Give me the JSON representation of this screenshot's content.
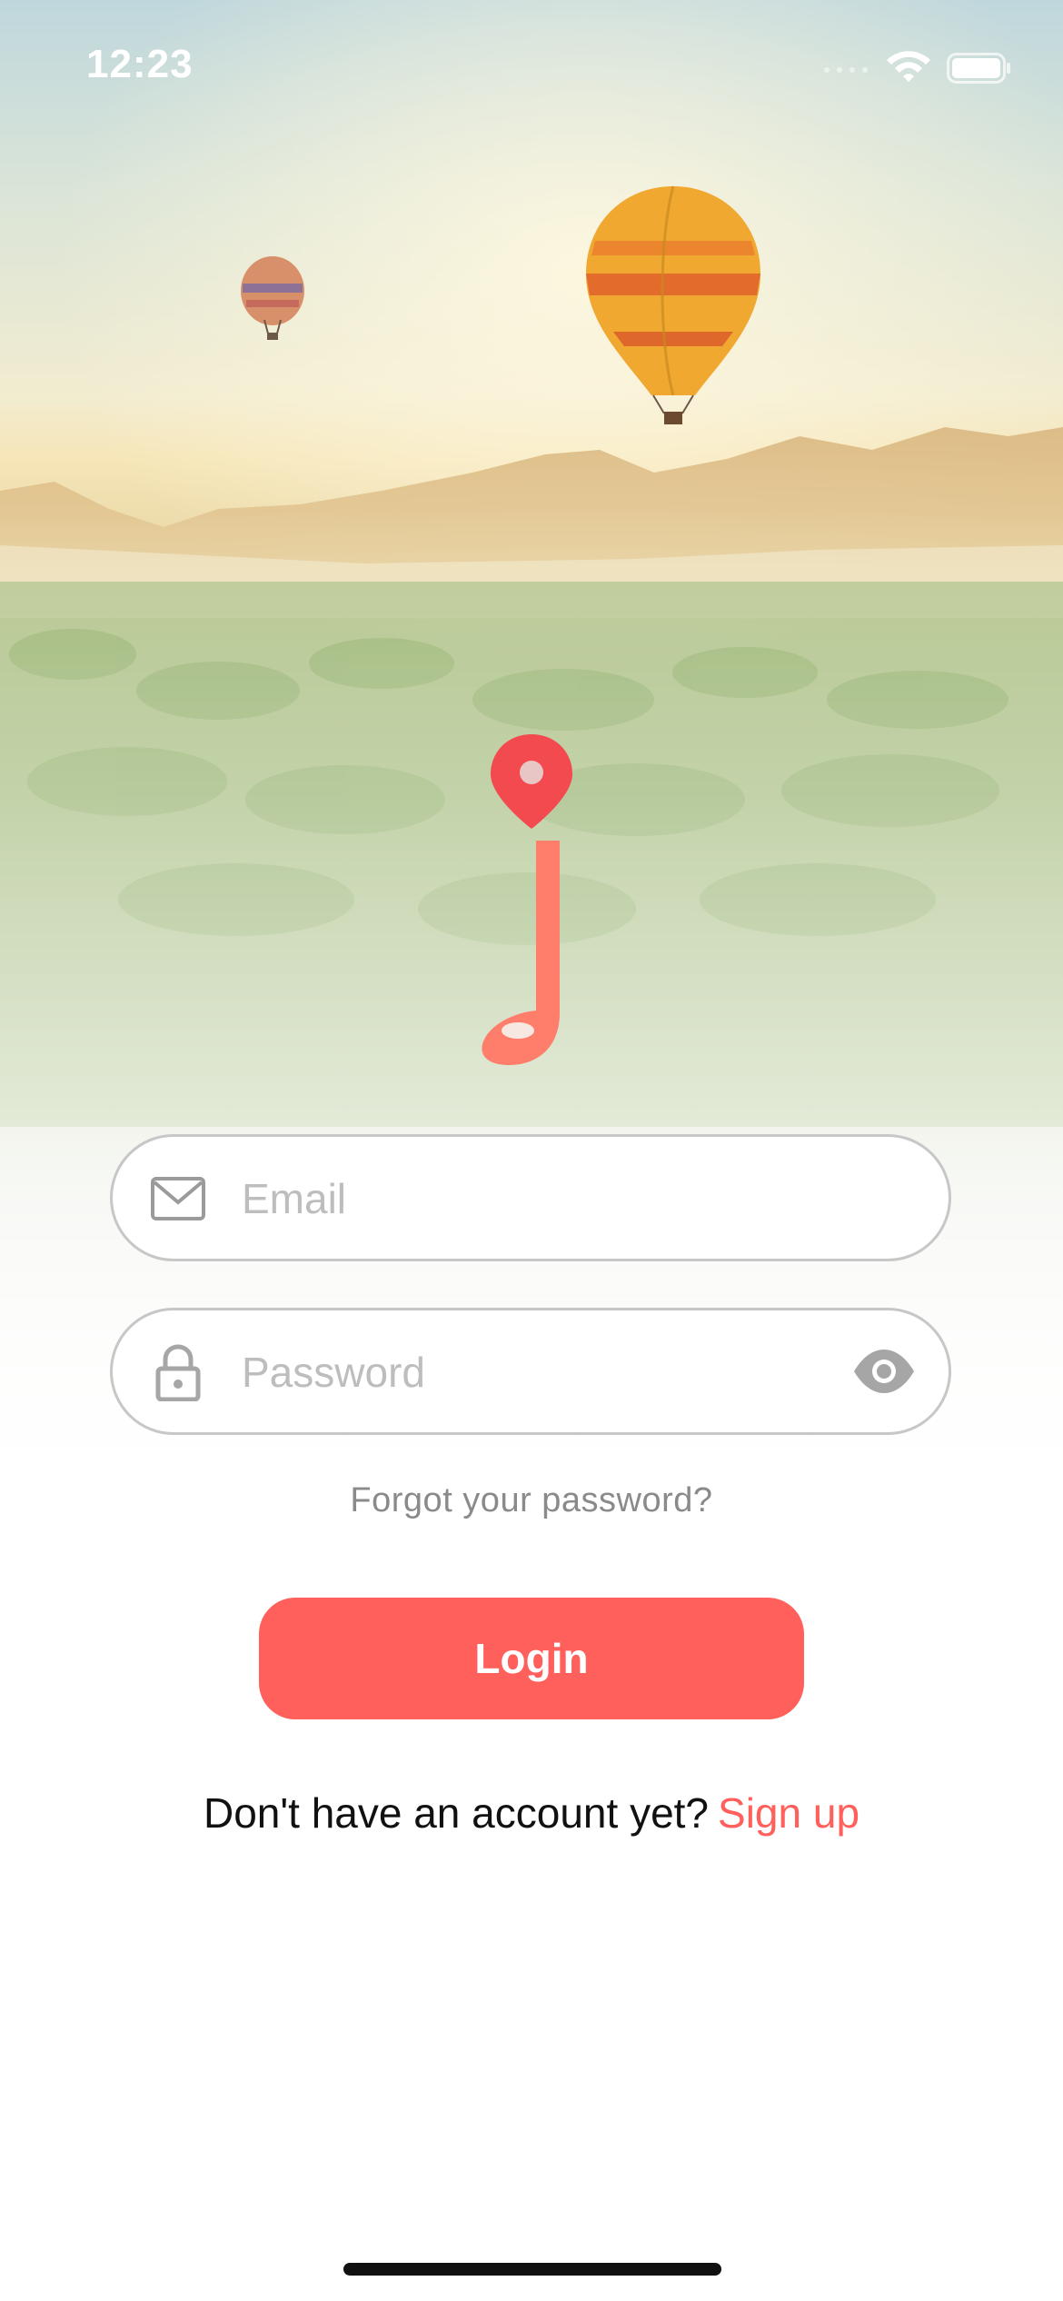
{
  "status_bar": {
    "time": "12:23"
  },
  "login_form": {
    "email_placeholder": "Email",
    "password_placeholder": "Password",
    "forgot_password": "Forgot your password?",
    "login_button": "Login"
  },
  "signup": {
    "prompt": "Don't have an account yet?",
    "link": "Sign up"
  },
  "icons": {
    "email": "envelope-icon",
    "password": "lock-icon",
    "toggle_visibility": "eye-icon",
    "logo": "map-pin-j-logo"
  },
  "colors": {
    "accent": "#ff605c",
    "logo_pin": "#f24a4f",
    "logo_j": "#ff7d6b",
    "field_border": "#c7c7c7",
    "placeholder": "#bdbdbd"
  }
}
